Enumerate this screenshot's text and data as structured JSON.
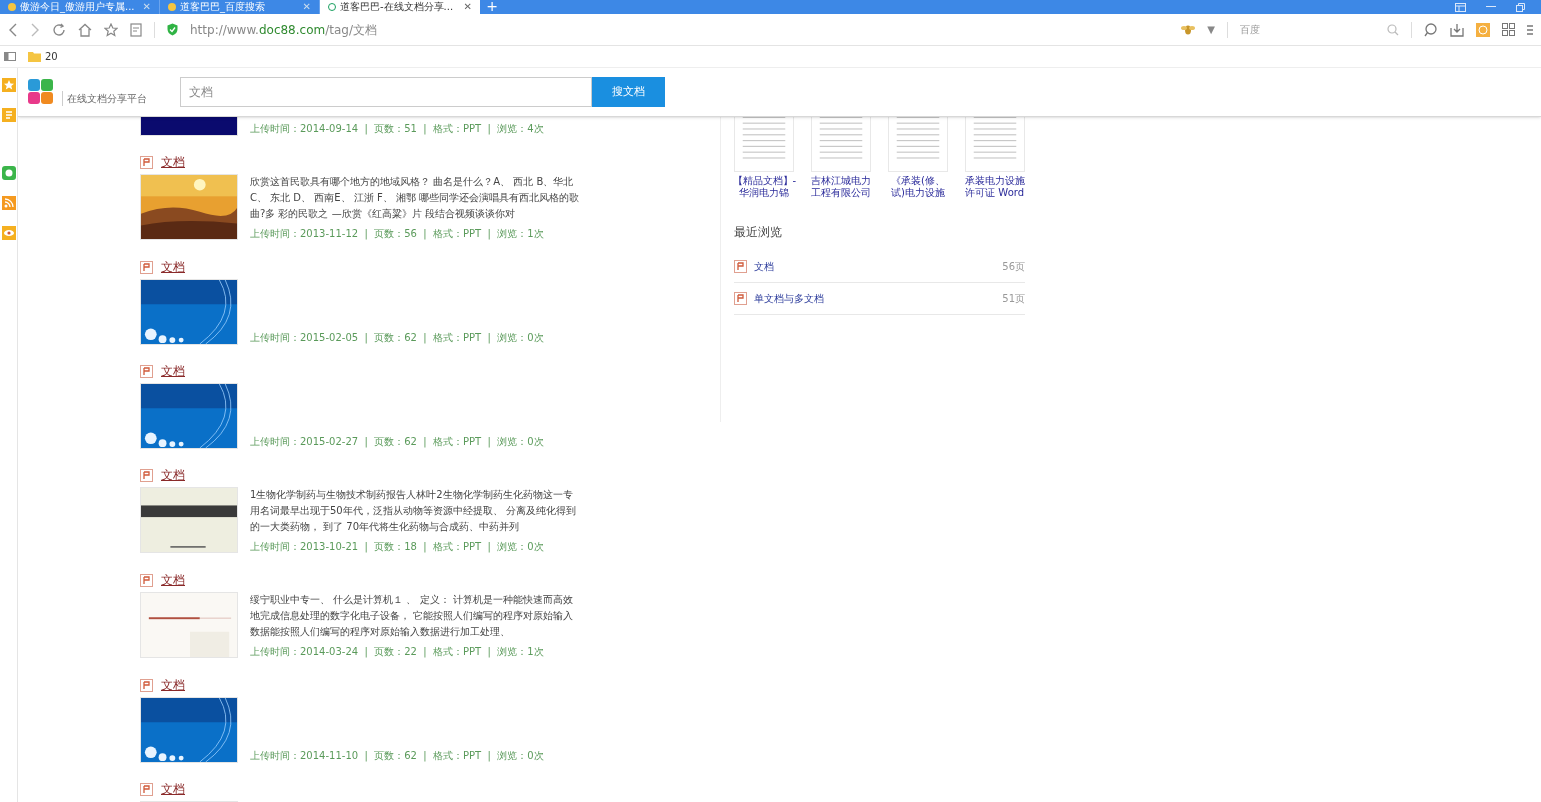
{
  "browser": {
    "tabs": [
      {
        "label": "傲游今日_傲游用户专属...",
        "close": "✕",
        "selected": false
      },
      {
        "label": "道客巴巴_百度搜索",
        "close": "✕",
        "selected": false
      },
      {
        "label": "道客巴巴-在线文档分享...",
        "close": "✕",
        "selected": true
      }
    ],
    "new_tab": "+",
    "address": {
      "scheme": "http://www.",
      "domain": "doc88.com",
      "path": "/tag/文档"
    },
    "search_engine_caret": "▼",
    "search": {
      "placeholder": "百度"
    },
    "bookmarks": [
      {
        "label": "20"
      }
    ]
  },
  "site_header": {
    "logo_subtitle": "在线文档分享平台",
    "search_value": "文档",
    "search_button": "搜文档"
  },
  "results": [
    {
      "meta": "上传时间：2014-09-14  |  页数：51  |  格式：PPT  |  浏览：4次"
    },
    {
      "title": "文档",
      "description": "欣赏这首民歌具有哪个地方的地域风格？ 曲名是什么？A、 西北 B、华北C、 东北 D、 西南E、 江浙 F、 湘鄂 哪些同学还会演唱具有西北风格的歌曲?多 彩的民歌之 —欣赏《红高粱》片 段结合视频谈谈你对",
      "meta": "上传时间：2013-11-12  |  页数：56  |  格式：PPT  |  浏览：1次"
    },
    {
      "title": "文档",
      "meta": "上传时间：2015-02-05  |  页数：62  |  格式：PPT  |  浏览：0次"
    },
    {
      "title": "文档",
      "meta": "上传时间：2015-02-27  |  页数：62  |  格式：PPT  |  浏览：0次"
    },
    {
      "title": "文档",
      "description": "1生物化学制药与生物技术制药报告人林叶2生物化学制药生化药物这一专用名词最早出现于50年代，泛指从动物等资源中经提取、 分离及纯化得到的一大类药物， 到了 70年代将生化药物与合成药、中药并列",
      "meta": "上传时间：2013-10-21  |  页数：18  |  格式：PPT  |  浏览：0次"
    },
    {
      "title": "文档",
      "description": "绥宁职业中专一、 什么是计算机１ 、 定义： 计算机是一种能快速而高效地完成信息处理的数字化电子设备， 它能按照人们编写的程序对原始输入数据能按照人们编写的程序对原始输入数据进行加工处理、",
      "meta": "上传时间：2014-03-24  |  页数：22  |  格式：PPT  |  浏览：1次"
    },
    {
      "title": "文档",
      "meta": "上传时间：2014-11-10  |  页数：62  |  格式：PPT  |  浏览：0次"
    },
    {
      "title": "文档"
    }
  ],
  "related_docs": [
    {
      "title": "【精品文档】-华润电力锦"
    },
    {
      "title": "吉林江城电力工程有限公司"
    },
    {
      "title": "《承装(修、试)电力设施"
    },
    {
      "title": "承装电力设施许可证 Word"
    }
  ],
  "recent": {
    "heading": "最近浏览",
    "items": [
      {
        "title": "文档",
        "pages": "56页"
      },
      {
        "title": "单文档与多文档",
        "pages": "51页"
      }
    ]
  }
}
